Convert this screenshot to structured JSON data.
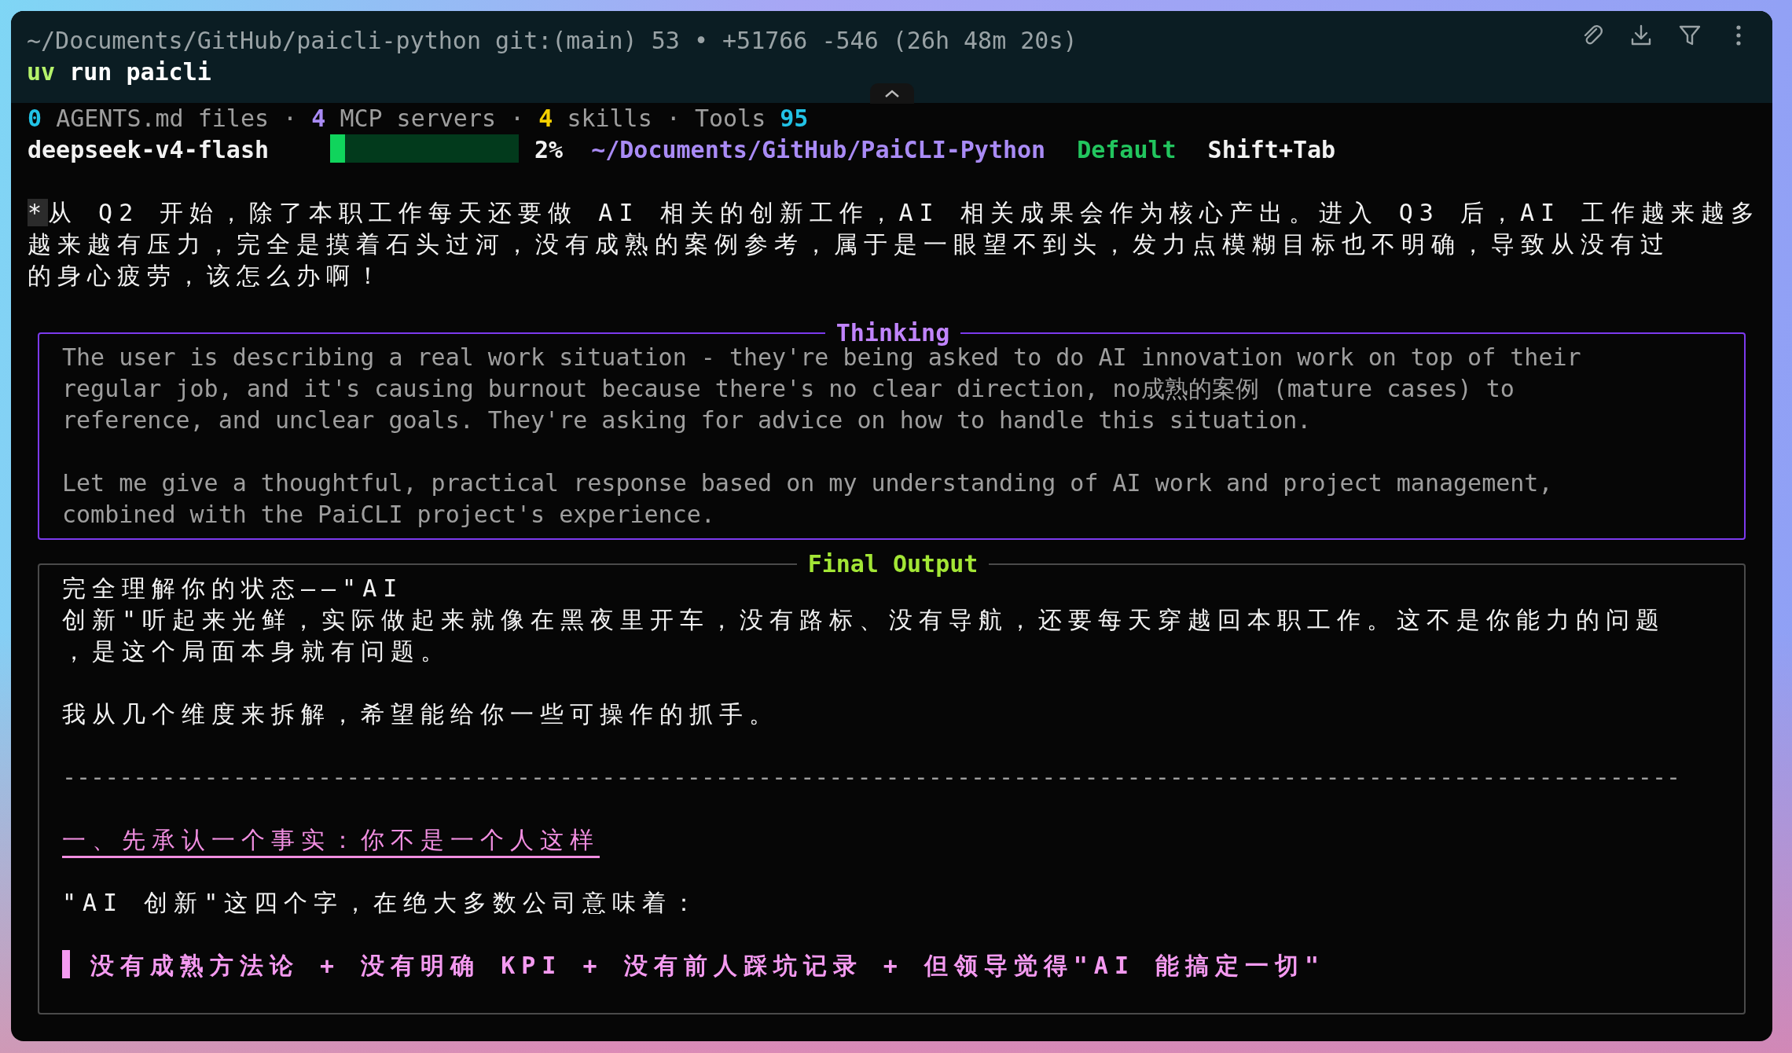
{
  "header": {
    "status_line": "~/Documents/GitHub/paicli-python git:(main) 53 • +51766 -546 (26h 48m 20s)",
    "command": {
      "program": "uv",
      "args": "run paicli"
    }
  },
  "stats": [
    {
      "kind": "count_first",
      "count": "0",
      "label": "AGENTS.md files",
      "color": "#22c3e6"
    },
    {
      "kind": "count_first",
      "count": "4",
      "label": "MCP servers",
      "color": "#a98bf5"
    },
    {
      "kind": "count_first",
      "count": "4",
      "label": "skills",
      "color": "#f5d000"
    },
    {
      "kind": "count_last",
      "count": "95",
      "label": "Tools",
      "color": "#22c3e6"
    }
  ],
  "separator": "·",
  "status": {
    "model": "deepseek-v4-flash",
    "context": {
      "level": 0.08,
      "reading": "2%"
    },
    "path": "~/Documents/GitHub/PaiCLI-Python",
    "mode": "Default",
    "shortcut": "Shift+Tab"
  },
  "user_message": {
    "marker": "*",
    "lines": [
      "从 Q2 开始，除了本职工作每天还要做 AI 相关的创新工作，AI 相关成果会作为核心产出。进入 Q3 后，AI 工作越来越多",
      "越来越有压力，完全是摸着石头过河，没有成熟的案例参考，属于是一眼望不到头，发力点模糊目标也不明确，导致从没有过",
      "的身心疲劳，该怎么办啊！"
    ]
  },
  "thinking": {
    "title": "Thinking",
    "paragraphs": [
      [
        "The user is describing a real work situation - they're being asked to do AI innovation work on top of their",
        "regular job, and it's causing burnout because there's no clear direction, no成熟的案例 (mature cases) to",
        "reference, and unclear goals. They're asking for advice on how to handle this situation."
      ],
      [
        "Let me give a thoughtful, practical response based on my understanding of AI work and project management,",
        "combined with the PaiCLI project's experience."
      ]
    ]
  },
  "final_output": {
    "title": "Final Output",
    "blocks": [
      {
        "kind": "text",
        "lines": [
          "完全理解你的状态——\"AI",
          "创新\"听起来光鲜，实际做起来就像在黑夜里开车，没有路标、没有导航，还要每天穿越回本职工作。这不是你能力的问题",
          "，是这个局面本身就有问题。"
        ]
      },
      {
        "kind": "text",
        "lines": [
          "我从几个维度来拆解，希望能给你一些可操作的抓手。"
        ]
      },
      {
        "kind": "rule",
        "text": "------------------------------------------------------------------------------------------------------------------"
      },
      {
        "kind": "heading",
        "text": "一、先承认一个事实：你不是一个人这样"
      },
      {
        "kind": "text",
        "lines": [
          "\"AI 创新\"这四个字，在绝大多数公司意味着："
        ]
      },
      {
        "kind": "quote",
        "text": "没有成熟方法论 + 没有明确 KPI + 没有前人踩坑记录 + 但领导觉得\"AI 能搞定一切\""
      }
    ]
  }
}
